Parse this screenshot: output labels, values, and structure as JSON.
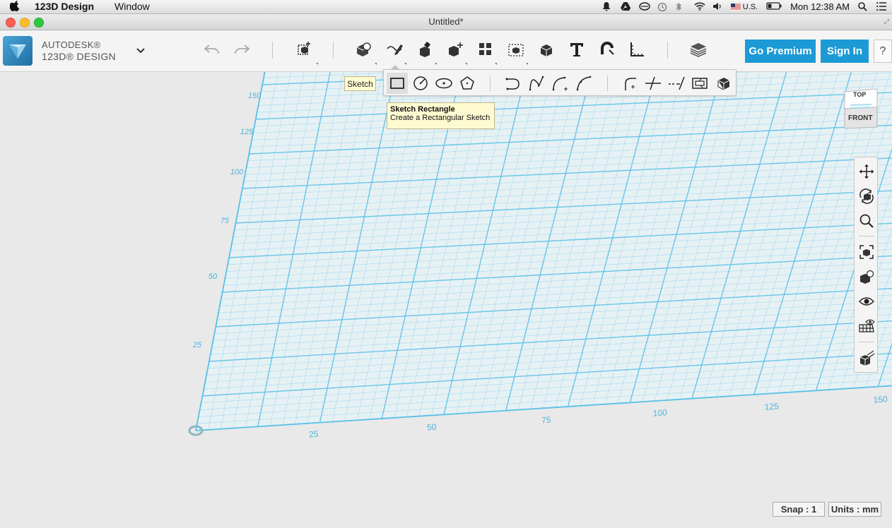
{
  "menubar": {
    "app_name": "123D Design",
    "menus": [
      "Window"
    ],
    "input_source": "U.S.",
    "clock": "Mon 12:38 AM"
  },
  "window": {
    "title": "Untitled*"
  },
  "brand": {
    "line1": "AUTODESK®",
    "line2": "123D® DESIGN"
  },
  "toolbar": {
    "tools": [
      {
        "name": "undo"
      },
      {
        "name": "redo"
      },
      {
        "name": "transform"
      },
      {
        "name": "primitives"
      },
      {
        "name": "sketch"
      },
      {
        "name": "construct"
      },
      {
        "name": "modify"
      },
      {
        "name": "pattern"
      },
      {
        "name": "grouping"
      },
      {
        "name": "combine"
      },
      {
        "name": "text"
      },
      {
        "name": "snap"
      },
      {
        "name": "measure"
      },
      {
        "name": "material"
      }
    ],
    "premium_label": "Go Premium",
    "signin_label": "Sign In",
    "help_label": "?"
  },
  "sketch_flyout": {
    "label": "Sketch",
    "active_tool": "sketch-rectangle",
    "tooltip": {
      "title": "Sketch Rectangle",
      "description": "Create a Rectangular Sketch"
    }
  },
  "viewcube": {
    "top_label": "TOP",
    "front_label": "FRONT"
  },
  "grid": {
    "x_ticks": [
      "25",
      "50",
      "75",
      "100",
      "125",
      "150"
    ],
    "y_ticks": [
      "25",
      "50",
      "75",
      "100",
      "125",
      "150"
    ],
    "line_color": "#5bc0e8"
  },
  "status": {
    "snap": "Snap : 1",
    "units": "Units : mm"
  }
}
